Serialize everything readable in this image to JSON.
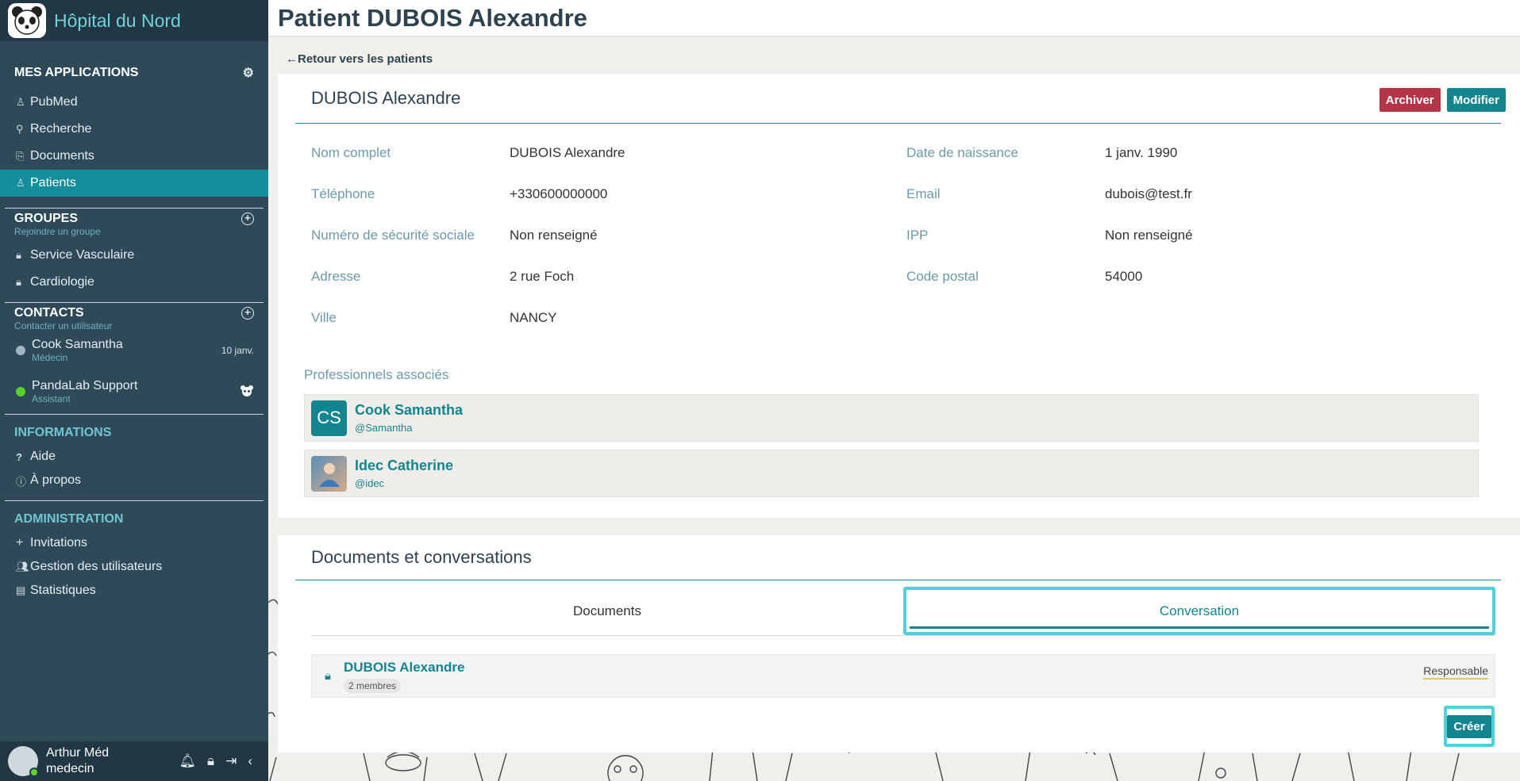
{
  "sidebar": {
    "brand": "Hôpital du Nord",
    "apps": {
      "heading": "MES APPLICATIONS",
      "items": [
        {
          "label": "PubMed",
          "icon": "pubmed-icon"
        },
        {
          "label": "Recherche",
          "icon": "search-icon"
        },
        {
          "label": "Documents",
          "icon": "paperclip-icon"
        },
        {
          "label": "Patients",
          "icon": "patient-icon",
          "active": true
        }
      ]
    },
    "groups": {
      "heading": "GROUPES",
      "subtitle": "Rejoindre un groupe",
      "items": [
        {
          "label": "Service Vasculaire",
          "icon": "lock-icon"
        },
        {
          "label": "Cardiologie",
          "icon": "lock-icon"
        }
      ]
    },
    "contacts": {
      "heading": "CONTACTS",
      "subtitle": "Contacter un utilisateur",
      "items": [
        {
          "name": "Cook Samantha",
          "role": "Médecin",
          "right": "10 janv.",
          "status_color": "#9fb6c2"
        },
        {
          "name": "PandaLab Support",
          "role": "Assistant",
          "right": "",
          "status_color": "#5bd22a"
        }
      ]
    },
    "informations": {
      "heading": "INFORMATIONS",
      "items": [
        {
          "label": "Aide",
          "icon": "question-icon"
        },
        {
          "label": "À propos",
          "icon": "info-icon"
        }
      ]
    },
    "administration": {
      "heading": "ADMINISTRATION",
      "items": [
        {
          "label": "Invitations",
          "icon": "plus-icon"
        },
        {
          "label": "Gestion des utilisateurs",
          "icon": "users-icon"
        },
        {
          "label": "Statistiques",
          "icon": "stats-icon"
        }
      ]
    },
    "user": {
      "name": "Arthur Méd",
      "role": "medecin"
    }
  },
  "header": {
    "title": "Patient DUBOIS Alexandre"
  },
  "back_link": "Retour vers les patients",
  "patient_card": {
    "title": "DUBOIS Alexandre",
    "archive_label": "Archiver",
    "modify_label": "Modifier",
    "rows": [
      {
        "l1": "Nom complet",
        "v1": "DUBOIS Alexandre",
        "l2": "Date de naissance",
        "v2": "1 janv. 1990"
      },
      {
        "l1": "Téléphone",
        "v1": "+330600000000",
        "l2": "Email",
        "v2": "dubois@test.fr"
      },
      {
        "l1": "Numéro de sécurité sociale",
        "v1": "Non renseigné",
        "l2": "IPP",
        "v2": "Non renseigné"
      },
      {
        "l1": "Adresse",
        "v1": "2 rue Foch",
        "l2": "Code postal",
        "v2": "54000"
      },
      {
        "l1": "Ville",
        "v1": "NANCY",
        "l2": "",
        "v2": ""
      }
    ],
    "associated_title": "Professionnels associés",
    "professionals": [
      {
        "initials": "CS",
        "name": "Cook Samantha",
        "username": "@Samantha"
      },
      {
        "initials": "",
        "name": "Idec Catherine",
        "username": "@idec"
      }
    ]
  },
  "docs_card": {
    "title": "Documents et conversations",
    "tabs": [
      {
        "label": "Documents",
        "active": false
      },
      {
        "label": "Conversation",
        "active": true
      }
    ],
    "conversation": {
      "name": "DUBOIS Alexandre",
      "members": "2 membres",
      "role": "Responsable"
    },
    "create_label": "Créer"
  }
}
